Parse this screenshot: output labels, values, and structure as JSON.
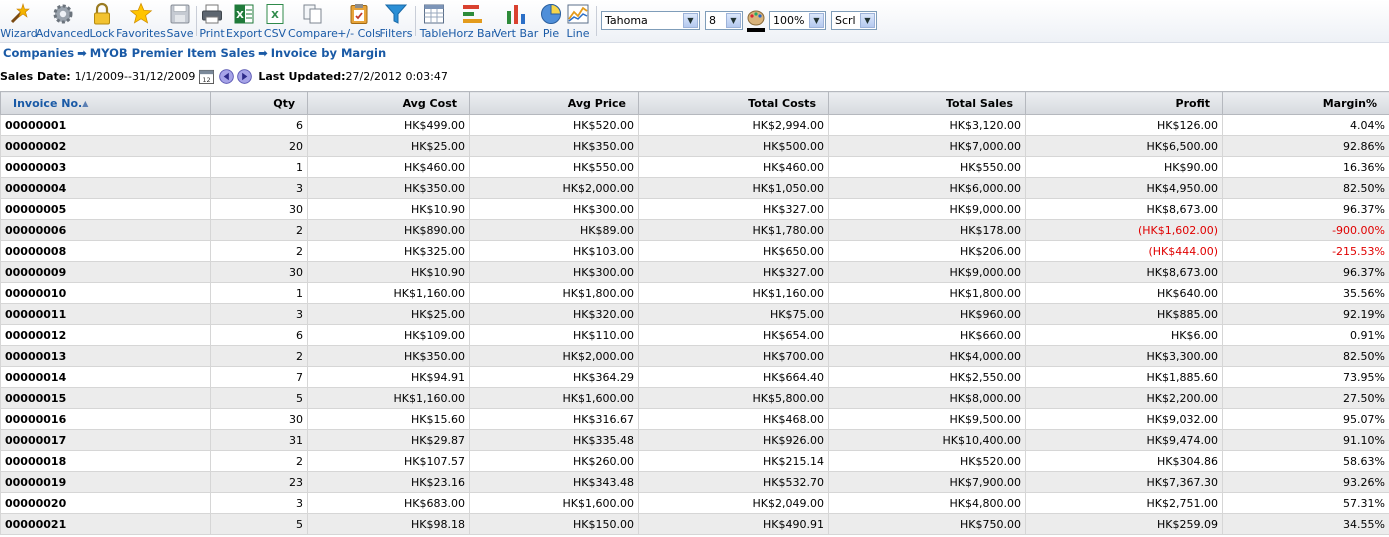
{
  "toolbar": {
    "buttons": [
      {
        "label": "Wizard",
        "icon": "wizard-wand-icon"
      },
      {
        "label": "Advanced",
        "icon": "gear-icon"
      },
      {
        "label": "Lock",
        "icon": "lock-icon"
      },
      {
        "label": "Favorites",
        "icon": "star-icon"
      },
      {
        "label": "Save",
        "icon": "save-disk-icon"
      },
      {
        "label": "Print",
        "icon": "printer-icon"
      },
      {
        "label": "Export",
        "icon": "excel-icon"
      },
      {
        "label": "CSV",
        "icon": "csv-icon"
      },
      {
        "label": "Compare",
        "icon": "compare-icon"
      },
      {
        "label": "+/- Cols",
        "icon": "columns-clipboard-icon"
      },
      {
        "label": "Filters",
        "icon": "funnel-icon"
      },
      {
        "label": "Table",
        "icon": "table-icon"
      },
      {
        "label": "Horz Bar",
        "icon": "horizontal-bar-chart-icon"
      },
      {
        "label": "Vert Bar",
        "icon": "vertical-bar-chart-icon"
      },
      {
        "label": "Pie",
        "icon": "pie-chart-icon"
      },
      {
        "label": "Line",
        "icon": "line-chart-icon"
      }
    ],
    "font_select": "Tahoma",
    "size_select": "8",
    "zoom_select": "100%",
    "scroll_select": "Scrl"
  },
  "breadcrumb": {
    "items": [
      "Companies",
      "MYOB Premier Item Sales",
      "Invoice by Margin"
    ]
  },
  "datebar": {
    "sales_date_label": "Sales Date:",
    "sales_date_value": "1/1/2009--31/12/2009",
    "last_updated_label": "Last Updated:",
    "last_updated_value": "27/2/2012 0:03:47"
  },
  "colors": {
    "link": "#1a5aa6",
    "negative": "#e00000",
    "row_alt": "#ececec"
  },
  "table": {
    "columns": [
      "Invoice No.",
      "Qty",
      "Avg Cost",
      "Avg Price",
      "Total Costs",
      "Total Sales",
      "Profit",
      "Margin%"
    ],
    "rows": [
      [
        "00000001",
        "6",
        "HK$499.00",
        "HK$520.00",
        "HK$2,994.00",
        "HK$3,120.00",
        "HK$126.00",
        "4.04%"
      ],
      [
        "00000002",
        "20",
        "HK$25.00",
        "HK$350.00",
        "HK$500.00",
        "HK$7,000.00",
        "HK$6,500.00",
        "92.86%"
      ],
      [
        "00000003",
        "1",
        "HK$460.00",
        "HK$550.00",
        "HK$460.00",
        "HK$550.00",
        "HK$90.00",
        "16.36%"
      ],
      [
        "00000004",
        "3",
        "HK$350.00",
        "HK$2,000.00",
        "HK$1,050.00",
        "HK$6,000.00",
        "HK$4,950.00",
        "82.50%"
      ],
      [
        "00000005",
        "30",
        "HK$10.90",
        "HK$300.00",
        "HK$327.00",
        "HK$9,000.00",
        "HK$8,673.00",
        "96.37%"
      ],
      [
        "00000006",
        "2",
        "HK$890.00",
        "HK$89.00",
        "HK$1,780.00",
        "HK$178.00",
        "(HK$1,602.00)",
        "-900.00%"
      ],
      [
        "00000008",
        "2",
        "HK$325.00",
        "HK$103.00",
        "HK$650.00",
        "HK$206.00",
        "(HK$444.00)",
        "-215.53%"
      ],
      [
        "00000009",
        "30",
        "HK$10.90",
        "HK$300.00",
        "HK$327.00",
        "HK$9,000.00",
        "HK$8,673.00",
        "96.37%"
      ],
      [
        "00000010",
        "1",
        "HK$1,160.00",
        "HK$1,800.00",
        "HK$1,160.00",
        "HK$1,800.00",
        "HK$640.00",
        "35.56%"
      ],
      [
        "00000011",
        "3",
        "HK$25.00",
        "HK$320.00",
        "HK$75.00",
        "HK$960.00",
        "HK$885.00",
        "92.19%"
      ],
      [
        "00000012",
        "6",
        "HK$109.00",
        "HK$110.00",
        "HK$654.00",
        "HK$660.00",
        "HK$6.00",
        "0.91%"
      ],
      [
        "00000013",
        "2",
        "HK$350.00",
        "HK$2,000.00",
        "HK$700.00",
        "HK$4,000.00",
        "HK$3,300.00",
        "82.50%"
      ],
      [
        "00000014",
        "7",
        "HK$94.91",
        "HK$364.29",
        "HK$664.40",
        "HK$2,550.00",
        "HK$1,885.60",
        "73.95%"
      ],
      [
        "00000015",
        "5",
        "HK$1,160.00",
        "HK$1,600.00",
        "HK$5,800.00",
        "HK$8,000.00",
        "HK$2,200.00",
        "27.50%"
      ],
      [
        "00000016",
        "30",
        "HK$15.60",
        "HK$316.67",
        "HK$468.00",
        "HK$9,500.00",
        "HK$9,032.00",
        "95.07%"
      ],
      [
        "00000017",
        "31",
        "HK$29.87",
        "HK$335.48",
        "HK$926.00",
        "HK$10,400.00",
        "HK$9,474.00",
        "91.10%"
      ],
      [
        "00000018",
        "2",
        "HK$107.57",
        "HK$260.00",
        "HK$215.14",
        "HK$520.00",
        "HK$304.86",
        "58.63%"
      ],
      [
        "00000019",
        "23",
        "HK$23.16",
        "HK$343.48",
        "HK$532.70",
        "HK$7,900.00",
        "HK$7,367.30",
        "93.26%"
      ],
      [
        "00000020",
        "3",
        "HK$683.00",
        "HK$1,600.00",
        "HK$2,049.00",
        "HK$4,800.00",
        "HK$2,751.00",
        "57.31%"
      ],
      [
        "00000021",
        "5",
        "HK$98.18",
        "HK$150.00",
        "HK$490.91",
        "HK$750.00",
        "HK$259.09",
        "34.55%"
      ]
    ]
  }
}
